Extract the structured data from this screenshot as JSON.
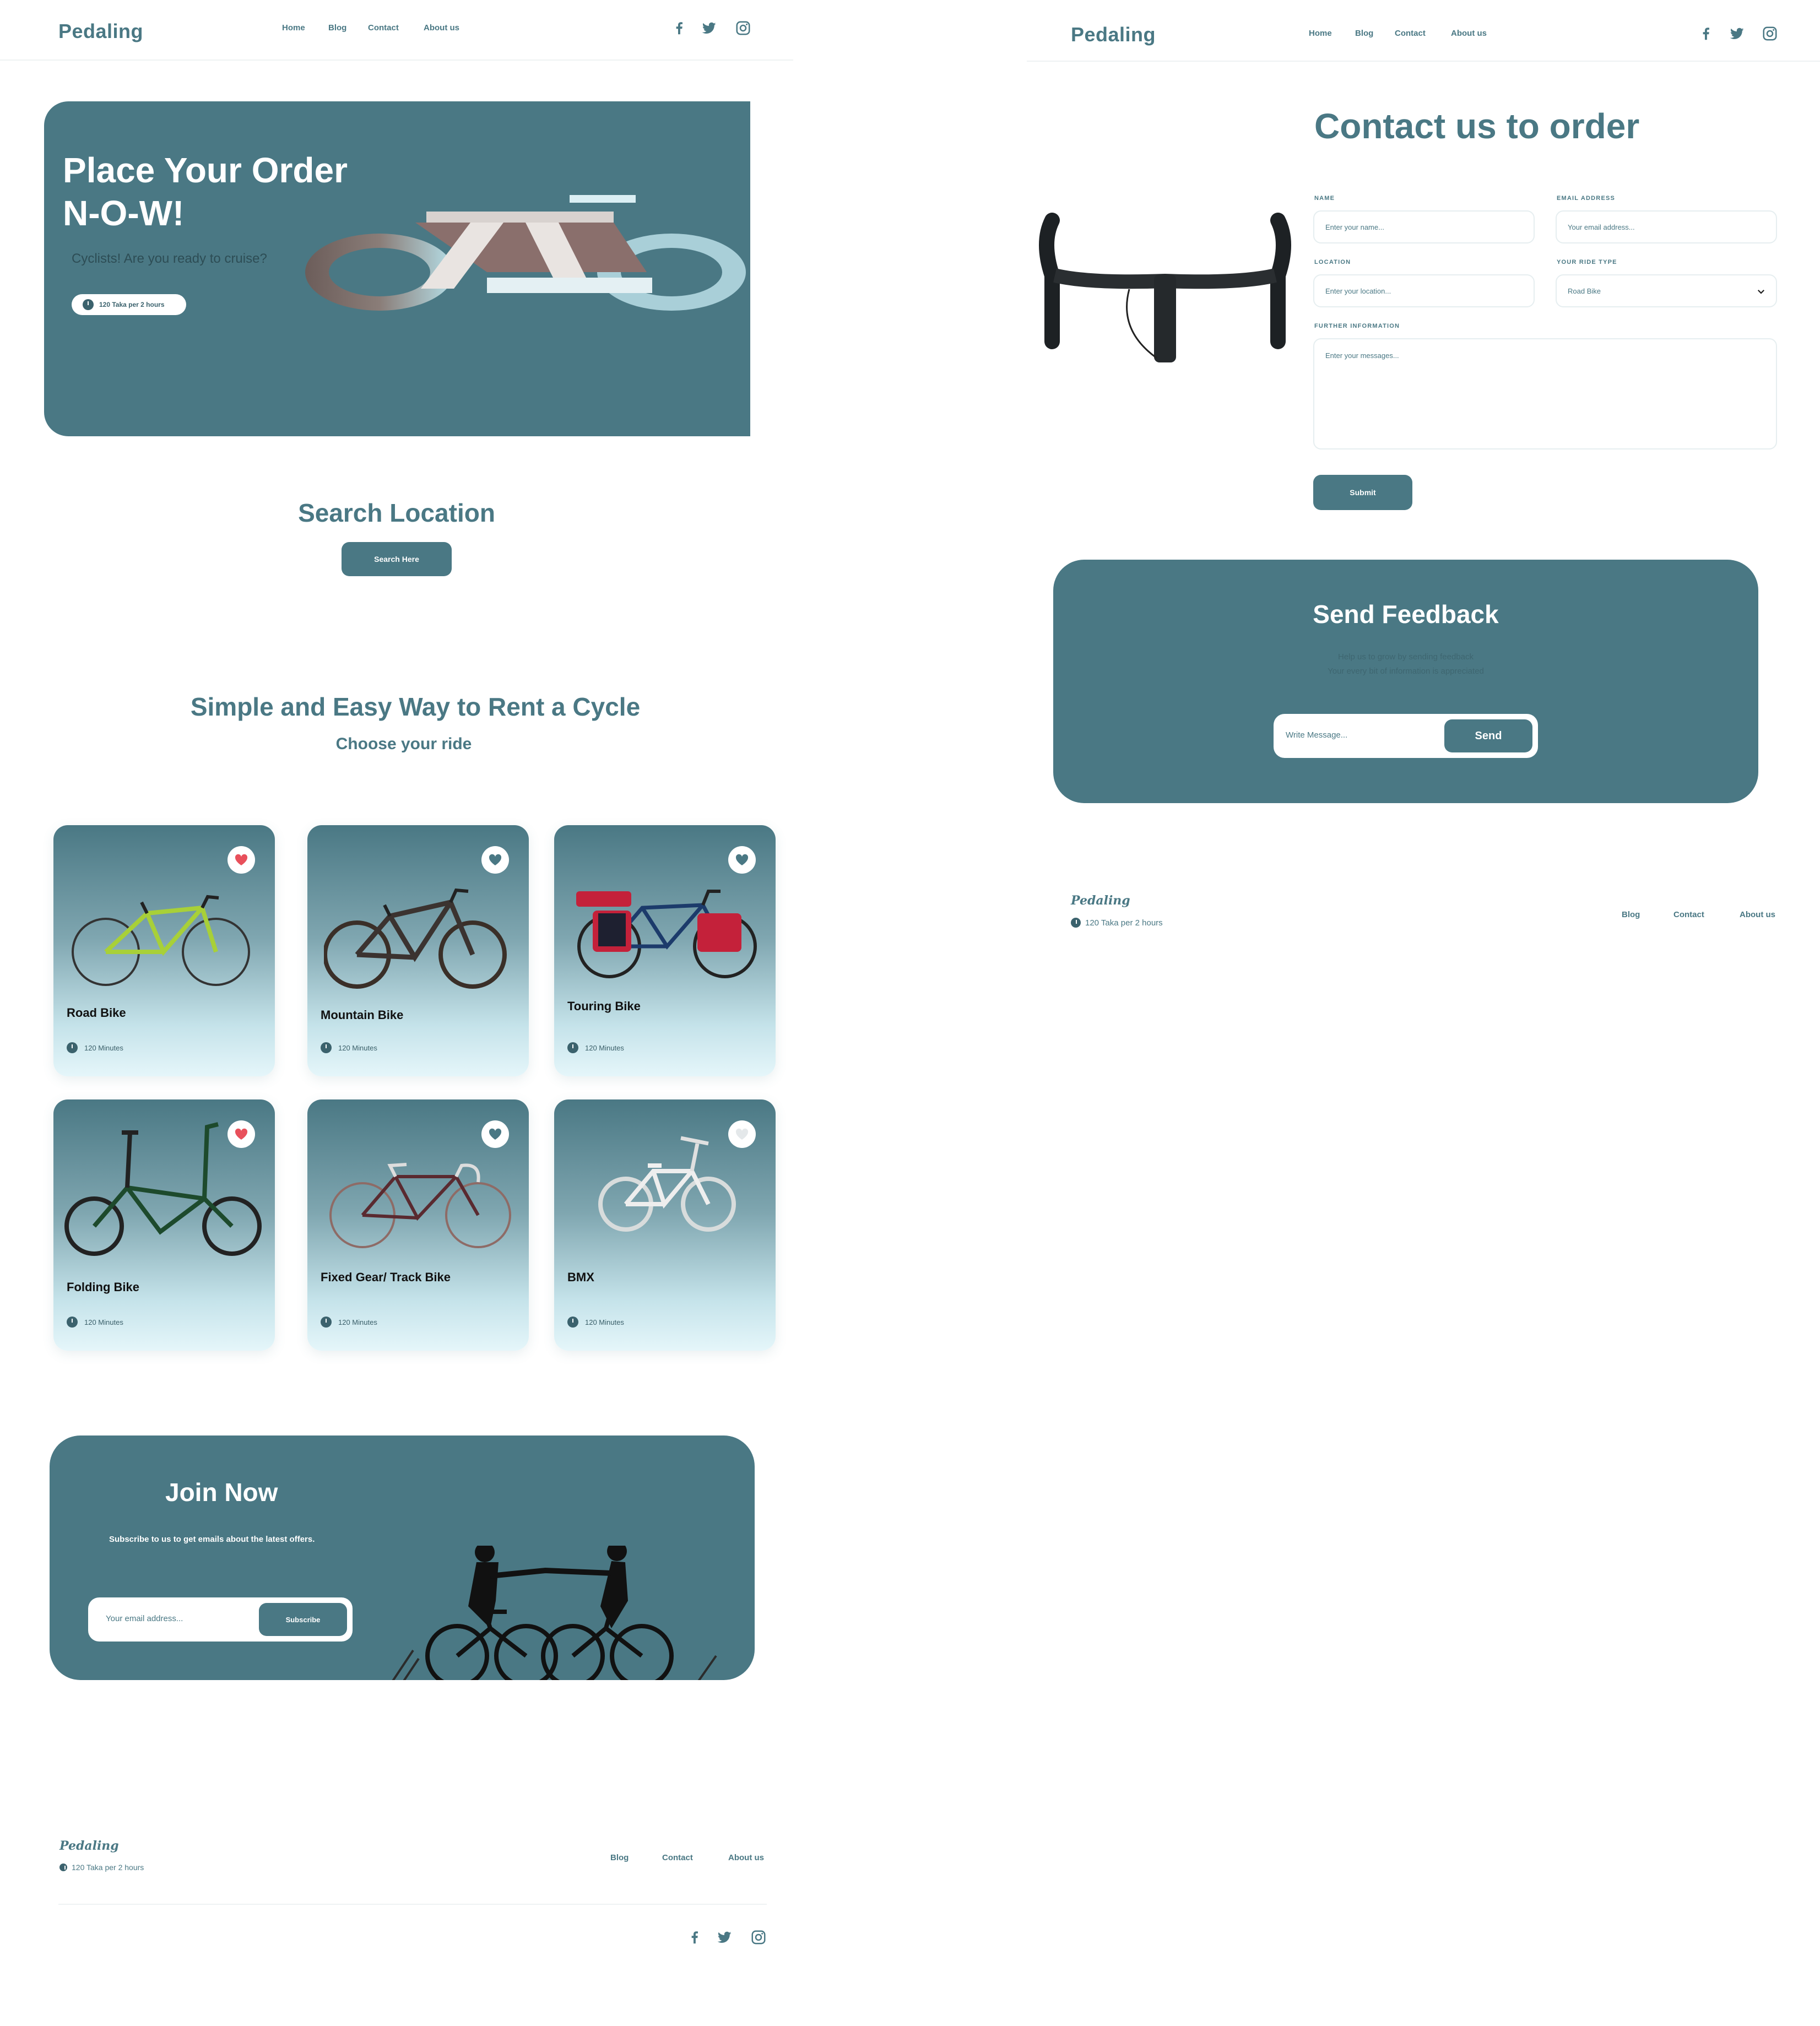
{
  "nav": {
    "logo": "Pedaling",
    "links": [
      "Home",
      "Blog",
      "Contact",
      "About us"
    ]
  },
  "hero": {
    "title_line1": "Place Your Order",
    "title_line2": "N-O-W!",
    "subtitle": "Cyclists! Are you ready to cruise?",
    "price_badge": "120 Taka per 2 hours"
  },
  "search": {
    "title": "Search Location",
    "button": "Search Here"
  },
  "rent": {
    "title": "Simple and Easy Way to Rent a Cycle",
    "subtitle": "Choose your ride",
    "cards": [
      {
        "name": "Road Bike",
        "time": "120 Minutes",
        "favorite": true
      },
      {
        "name": "Mountain Bike",
        "time": "120 Minutes",
        "favorite": false
      },
      {
        "name": "Touring Bike",
        "time": "120 Minutes",
        "favorite": false
      },
      {
        "name": "Folding Bike",
        "time": "120 Minutes",
        "favorite": true
      },
      {
        "name": "Fixed Gear/ Track Bike",
        "time": "120 Minutes",
        "favorite": false
      },
      {
        "name": "BMX",
        "time": "120 Minutes",
        "favorite": false
      }
    ]
  },
  "join": {
    "title": "Join Now",
    "text": "Subscribe to us to get emails about the latest offers.",
    "email_placeholder": "Your email address...",
    "button": "Subscribe"
  },
  "footer": {
    "logo": "Pedaling",
    "price": "120 Taka per 2 hours",
    "links": [
      "Blog",
      "Contact",
      "About us"
    ]
  },
  "contact": {
    "title": "Contact us to order",
    "name_label": "NAME",
    "name_placeholder": "Enter your name...",
    "email_label": "EMAIL ADDRESS",
    "email_placeholder": "Your email address...",
    "location_label": "LOCATION",
    "location_placeholder": "Enter your location...",
    "ride_label": "YOUR RIDE TYPE",
    "ride_value": "Road Bike",
    "info_label": "FURTHER INFORMATION",
    "info_placeholder": "Enter your messages...",
    "submit": "Submit"
  },
  "feedback": {
    "title": "Send Feedback",
    "line1": "Help us to grow by sending feedback",
    "line2": "Your every bit of information is appreciated",
    "placeholder": "Write Message...",
    "button": "Send"
  },
  "colors": {
    "brand": "#4a7884",
    "favorite": "#e8505b"
  },
  "icons": [
    "facebook-icon",
    "twitter-icon",
    "instagram-icon",
    "heart-icon",
    "clock-icon",
    "chevron-down-icon"
  ]
}
